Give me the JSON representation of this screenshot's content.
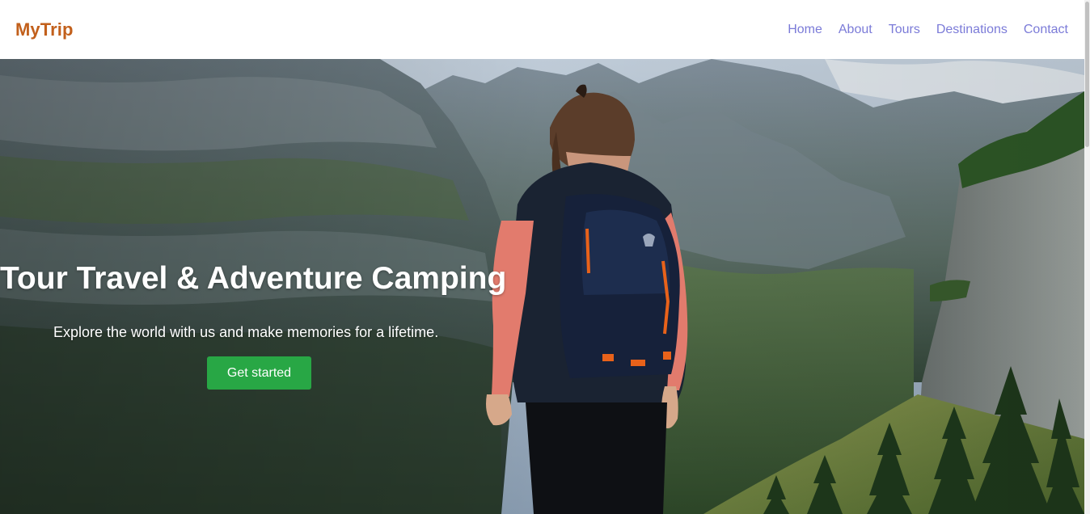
{
  "nav": {
    "logo": "MyTrip",
    "links": [
      "Home",
      "About",
      "Tours",
      "Destinations",
      "Contact"
    ]
  },
  "hero": {
    "title": "Tour Travel & Adventure Camping",
    "subtitle": "Explore the world with us and make memories for a lifetime.",
    "cta_label": "Get started"
  },
  "colors": {
    "logo": "#c2601c",
    "nav_link": "#7b7bd8",
    "cta_background": "#28a745",
    "hero_text": "#ffffff"
  }
}
